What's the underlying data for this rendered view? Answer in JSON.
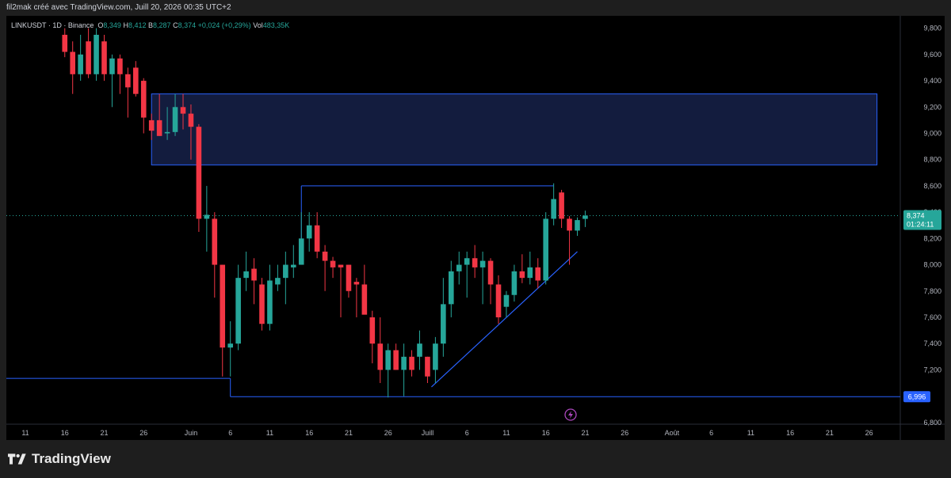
{
  "header": {
    "title": "fil2mak créé avec TradingView.com, Juill 20, 2026 00:35 UTC+2"
  },
  "legend": {
    "symbol": "LINKUSDT · 1D · Binance",
    "o_label": "O",
    "o_value": "8,349",
    "h_label": "H",
    "h_value": "8,412",
    "b_label": "B",
    "b_value": "8,287",
    "c_label": "C",
    "c_value": "8,374",
    "change": "+0,024 (+0,29%)",
    "vol_label": "Vol",
    "vol_value": "483,35K"
  },
  "price_tag": {
    "price": "8,374",
    "countdown": "01:24:11"
  },
  "support_tag": "6,996",
  "brand": "TradingView",
  "colors": {
    "up": "#26a69a",
    "down": "#f23645",
    "drawing": "#2962ff",
    "zone_fill": "#131c3e",
    "support_tag": "#2962ff"
  },
  "chart_data": {
    "type": "candlestick",
    "symbol": "LINKUSDT",
    "interval": "1D",
    "exchange": "Binance",
    "ylim": [
      6.7,
      9.8
    ],
    "y_ticks": [
      "6,800",
      "7,200",
      "7,400",
      "7,600",
      "7,800",
      "8,000",
      "8,200",
      "8,400",
      "8,600",
      "8,800",
      "9,000",
      "9,200",
      "9,400",
      "9,600",
      "9,800"
    ],
    "x_ticks": [
      {
        "label": "11",
        "day": 0
      },
      {
        "label": "16",
        "day": 5
      },
      {
        "label": "21",
        "day": 10
      },
      {
        "label": "26",
        "day": 15
      },
      {
        "label": "Juin",
        "day": 21
      },
      {
        "label": "6",
        "day": 26
      },
      {
        "label": "11",
        "day": 31
      },
      {
        "label": "16",
        "day": 36
      },
      {
        "label": "21",
        "day": 41
      },
      {
        "label": "26",
        "day": 46
      },
      {
        "label": "Juill",
        "day": 51
      },
      {
        "label": "6",
        "day": 56
      },
      {
        "label": "11",
        "day": 61
      },
      {
        "label": "16",
        "day": 66
      },
      {
        "label": "21",
        "day": 71
      },
      {
        "label": "26",
        "day": 76
      },
      {
        "label": "Août",
        "day": 82
      },
      {
        "label": "6",
        "day": 87
      },
      {
        "label": "11",
        "day": 92
      },
      {
        "label": "16",
        "day": 97
      },
      {
        "label": "21",
        "day": 102
      },
      {
        "label": "26",
        "day": 107
      }
    ],
    "candles": [
      {
        "day": 5,
        "o": 9.75,
        "h": 9.8,
        "l": 9.58,
        "c": 9.62
      },
      {
        "day": 6,
        "o": 9.62,
        "h": 9.7,
        "l": 9.3,
        "c": 9.45
      },
      {
        "day": 7,
        "o": 9.45,
        "h": 9.75,
        "l": 9.4,
        "c": 9.6
      },
      {
        "day": 8,
        "o": 9.7,
        "h": 9.8,
        "l": 9.42,
        "c": 9.45
      },
      {
        "day": 9,
        "o": 9.45,
        "h": 9.8,
        "l": 9.4,
        "c": 9.75
      },
      {
        "day": 10,
        "o": 9.7,
        "h": 9.75,
        "l": 9.4,
        "c": 9.45
      },
      {
        "day": 11,
        "o": 9.45,
        "h": 9.6,
        "l": 9.2,
        "c": 9.57
      },
      {
        "day": 12,
        "o": 9.57,
        "h": 9.6,
        "l": 9.3,
        "c": 9.45
      },
      {
        "day": 13,
        "o": 9.45,
        "h": 9.5,
        "l": 9.12,
        "c": 9.35
      },
      {
        "day": 14,
        "o": 9.5,
        "h": 9.55,
        "l": 9.28,
        "c": 9.3
      },
      {
        "day": 15,
        "o": 9.4,
        "h": 9.42,
        "l": 9.0,
        "c": 9.12
      },
      {
        "day": 16,
        "o": 9.1,
        "h": 9.15,
        "l": 8.95,
        "c": 9.02
      },
      {
        "day": 17,
        "o": 9.1,
        "h": 9.3,
        "l": 8.98,
        "c": 8.98
      },
      {
        "day": 18,
        "o": 9.0,
        "h": 9.2,
        "l": 8.95,
        "c": 9.01
      },
      {
        "day": 19,
        "o": 9.01,
        "h": 9.3,
        "l": 8.98,
        "c": 9.2
      },
      {
        "day": 20,
        "o": 9.2,
        "h": 9.3,
        "l": 9.03,
        "c": 9.15
      },
      {
        "day": 21,
        "o": 9.15,
        "h": 9.22,
        "l": 8.8,
        "c": 9.05
      },
      {
        "day": 22,
        "o": 9.05,
        "h": 9.07,
        "l": 8.25,
        "c": 8.35
      },
      {
        "day": 23,
        "o": 8.35,
        "h": 8.6,
        "l": 8.1,
        "c": 8.38
      },
      {
        "day": 24,
        "o": 8.35,
        "h": 8.4,
        "l": 7.75,
        "c": 8.0
      },
      {
        "day": 25,
        "o": 8.0,
        "h": 8.0,
        "l": 7.15,
        "c": 7.37
      },
      {
        "day": 26,
        "o": 7.37,
        "h": 7.57,
        "l": 7.15,
        "c": 7.4
      },
      {
        "day": 27,
        "o": 7.4,
        "h": 8.0,
        "l": 7.35,
        "c": 7.9
      },
      {
        "day": 28,
        "o": 7.9,
        "h": 8.1,
        "l": 7.8,
        "c": 7.95
      },
      {
        "day": 29,
        "o": 7.97,
        "h": 8.05,
        "l": 7.7,
        "c": 7.88
      },
      {
        "day": 30,
        "o": 7.85,
        "h": 7.9,
        "l": 7.5,
        "c": 7.55
      },
      {
        "day": 31,
        "o": 7.55,
        "h": 8.0,
        "l": 7.5,
        "c": 7.88
      },
      {
        "day": 32,
        "o": 7.85,
        "h": 8.0,
        "l": 7.8,
        "c": 7.9
      },
      {
        "day": 33,
        "o": 7.9,
        "h": 8.1,
        "l": 7.7,
        "c": 8.0
      },
      {
        "day": 34,
        "o": 7.98,
        "h": 8.15,
        "l": 7.9,
        "c": 8.0
      },
      {
        "day": 35,
        "o": 8.0,
        "h": 8.4,
        "l": 8.0,
        "c": 8.2
      },
      {
        "day": 36,
        "o": 8.2,
        "h": 8.4,
        "l": 8.1,
        "c": 8.3
      },
      {
        "day": 37,
        "o": 8.3,
        "h": 8.4,
        "l": 8.05,
        "c": 8.1
      },
      {
        "day": 38,
        "o": 8.1,
        "h": 8.15,
        "l": 7.8,
        "c": 8.03
      },
      {
        "day": 39,
        "o": 8.03,
        "h": 8.06,
        "l": 7.9,
        "c": 7.98
      },
      {
        "day": 40,
        "o": 8.0,
        "h": 8.0,
        "l": 7.6,
        "c": 7.98
      },
      {
        "day": 41,
        "o": 8.0,
        "h": 8.0,
        "l": 7.75,
        "c": 7.8
      },
      {
        "day": 42,
        "o": 7.87,
        "h": 7.9,
        "l": 7.6,
        "c": 7.85
      },
      {
        "day": 43,
        "o": 7.85,
        "h": 8.0,
        "l": 7.75,
        "c": 7.62
      },
      {
        "day": 44,
        "o": 7.6,
        "h": 7.65,
        "l": 7.25,
        "c": 7.4
      },
      {
        "day": 45,
        "o": 7.4,
        "h": 7.6,
        "l": 7.1,
        "c": 7.2
      },
      {
        "day": 46,
        "o": 7.2,
        "h": 7.4,
        "l": 6.99,
        "c": 7.35
      },
      {
        "day": 47,
        "o": 7.35,
        "h": 7.4,
        "l": 7.2,
        "c": 7.2
      },
      {
        "day": 48,
        "o": 7.2,
        "h": 7.4,
        "l": 7.0,
        "c": 7.3
      },
      {
        "day": 49,
        "o": 7.3,
        "h": 7.35,
        "l": 7.15,
        "c": 7.2
      },
      {
        "day": 50,
        "o": 7.3,
        "h": 7.5,
        "l": 7.2,
        "c": 7.4
      },
      {
        "day": 51,
        "o": 7.3,
        "h": 7.3,
        "l": 7.1,
        "c": 7.15
      },
      {
        "day": 52,
        "o": 7.2,
        "h": 7.45,
        "l": 7.1,
        "c": 7.4
      },
      {
        "day": 53,
        "o": 7.4,
        "h": 7.9,
        "l": 7.3,
        "c": 7.7
      },
      {
        "day": 54,
        "o": 7.7,
        "h": 8.03,
        "l": 7.6,
        "c": 7.95
      },
      {
        "day": 55,
        "o": 7.95,
        "h": 8.1,
        "l": 7.85,
        "c": 8.0
      },
      {
        "day": 56,
        "o": 8.0,
        "h": 8.1,
        "l": 7.75,
        "c": 8.05
      },
      {
        "day": 57,
        "o": 8.05,
        "h": 8.15,
        "l": 7.9,
        "c": 7.98
      },
      {
        "day": 58,
        "o": 7.98,
        "h": 8.1,
        "l": 7.7,
        "c": 8.03
      },
      {
        "day": 59,
        "o": 8.03,
        "h": 8.05,
        "l": 7.7,
        "c": 7.85
      },
      {
        "day": 60,
        "o": 7.85,
        "h": 7.92,
        "l": 7.55,
        "c": 7.6
      },
      {
        "day": 61,
        "o": 7.68,
        "h": 7.8,
        "l": 7.6,
        "c": 7.77
      },
      {
        "day": 62,
        "o": 7.77,
        "h": 8.0,
        "l": 7.72,
        "c": 7.95
      },
      {
        "day": 63,
        "o": 7.95,
        "h": 8.08,
        "l": 7.86,
        "c": 7.9
      },
      {
        "day": 64,
        "o": 7.9,
        "h": 8.1,
        "l": 7.85,
        "c": 7.98
      },
      {
        "day": 65,
        "o": 7.98,
        "h": 8.05,
        "l": 7.82,
        "c": 7.88
      },
      {
        "day": 66,
        "o": 7.88,
        "h": 8.4,
        "l": 7.85,
        "c": 8.35
      },
      {
        "day": 67,
        "o": 8.35,
        "h": 8.62,
        "l": 8.3,
        "c": 8.5
      },
      {
        "day": 68,
        "o": 8.55,
        "h": 8.57,
        "l": 8.28,
        "c": 8.35
      },
      {
        "day": 69,
        "o": 8.35,
        "h": 8.37,
        "l": 8.0,
        "c": 8.26
      },
      {
        "day": 70,
        "o": 8.26,
        "h": 8.36,
        "l": 8.22,
        "c": 8.34
      },
      {
        "day": 71,
        "o": 8.349,
        "h": 8.412,
        "l": 8.287,
        "c": 8.374
      }
    ],
    "drawings": {
      "supply_zone": {
        "day_start": 16,
        "day_end": 108,
        "price_top": 9.3,
        "price_bottom": 8.76
      },
      "support_line": {
        "price": 6.996,
        "day_start": 26
      },
      "left_level": {
        "price": 7.135,
        "day_start": -5,
        "day_end": 26
      },
      "neckline": {
        "price": 8.6,
        "day_start": 35,
        "day_end": 67
      },
      "neckline_riser": {
        "day": 35,
        "price_from": 8.6,
        "price_to": 8.2
      },
      "trendline": {
        "day_start": 51.5,
        "price_start": 7.07,
        "day_end": 70,
        "price_end": 8.1
      }
    }
  }
}
